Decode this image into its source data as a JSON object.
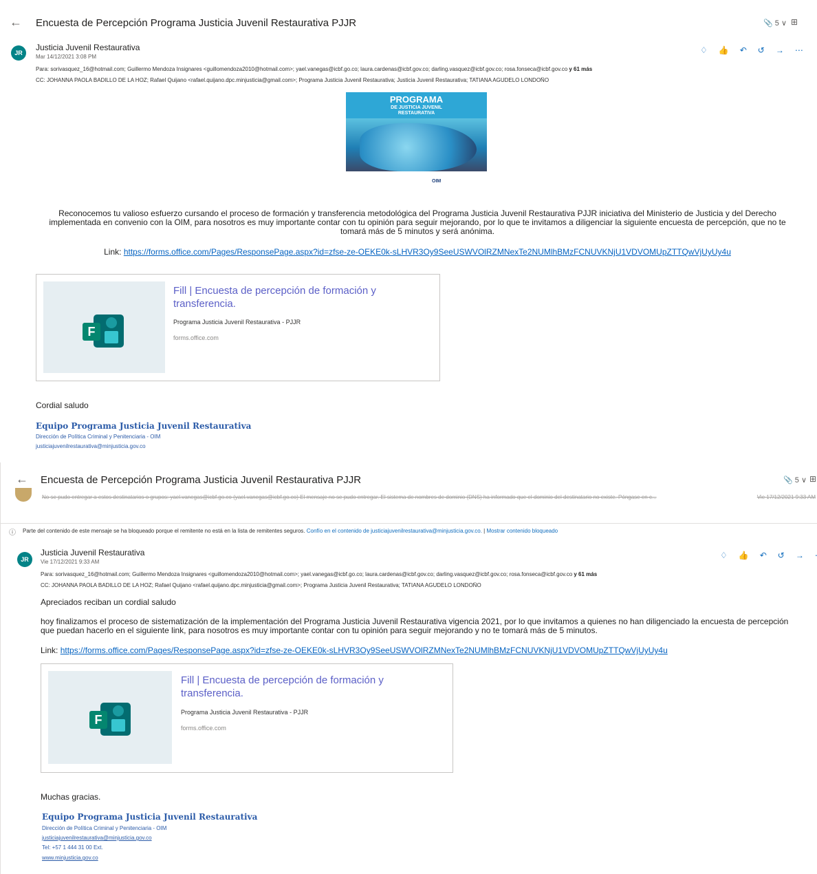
{
  "email1": {
    "subject": "Encuesta de Percepción Programa Justicia Juvenil Restaurativa PJJR",
    "attachments_count": "5",
    "avatar_initials": "JR",
    "sender": "Justicia Juvenil Restaurativa",
    "date": "Mar 14/12/2021 3:08 PM",
    "to_label": "Para:",
    "to_list": "sorivasquez_16@hotmail.com; Guillermo Mendoza Insignares <guillomendoza2010@hotmail.com>; yael.vanegas@icbf.go.co; laura.cardenas@icbf.gov.co; darling.vasquez@icbf.gov.co; rosa.fonseca@icbf.gov.co",
    "to_more": "y 61 más",
    "cc_label": "CC:",
    "cc_list": "JOHANNA PAOLA BADILLO DE LA HOZ; Rafael Quijano <rafael.quijano.dpc.minjusticia@gmail.com>; Programa Justicia Juvenil Restaurativa; Justicia Juvenil Restaurativa; TATIANA AGUDELO LONDOÑO",
    "banner": {
      "line1": "PROGRAMA",
      "line2": "DE JUSTICIA JUVENIL",
      "line3": "RESTAURATIVA",
      "logos": "OIM"
    },
    "body": "Reconocemos tu valioso esfuerzo cursando el proceso de formación y transferencia metodológica del Programa Justicia Juvenil Restaurativa PJJR iniciativa del Ministerio de Justicia y del Derecho implementada en convenio con la OIM, para nosotros es muy importante contar con tu opinión para seguir mejorando, por lo que te invitamos a diligenciar la siguiente encuesta de percepción, que no te tomará más de 5 minutos y será anónima.",
    "link_label": "Link:",
    "link_url": "https://forms.office.com/Pages/ResponsePage.aspx?id=zfse-ze-OEKE0k-sLHVR3Oy9SeeUSWVOlRZMNexTe2NUMlhBMzFCNUVKNjU1VDVOMUpZTTQwVjUyUy4u",
    "card": {
      "title": "Fill | Encuesta de percepción de formación y transferencia.",
      "org": "Programa Justicia Juvenil Restaurativa - PJJR",
      "domain": "forms.office.com",
      "icon_letter": "F"
    },
    "closing": "Cordial saludo",
    "sig_name": "Equipo Programa Justicia Juvenil Restaurativa",
    "sig_dept": "Dirección de Política Criminal y Penitenciaria - OIM",
    "sig_email": "justiciajuvenilrestaurativa@minjusticia.gov.co"
  },
  "email2": {
    "subject": "Encuesta de Percepción Programa Justicia Juvenil Restaurativa PJJR",
    "attachments_count": "5",
    "ndr_text": "No se pudo entregar a estos destinatarios o grupos: yael.vanegas@icbf.go.co (yael.vanegas@icbf.go.co) El mensaje no se pudo entregar. El sistema de nombres de dominio (DNS) ha informado que el dominio del destinatario no existe. Póngase en c...",
    "ndr_date": "Vie 17/12/2021 9:33 AM",
    "blocked_text": "Parte del contenido de este mensaje se ha bloqueado porque el remitente no está en la lista de remitentes seguros.",
    "blocked_trust": "Confío en el contenido de justiciajuvenilrestaurativa@minjusticia.gov.co.",
    "blocked_sep": "|",
    "blocked_show": "Mostrar contenido bloqueado",
    "avatar_initials": "JR",
    "sender": "Justicia Juvenil Restaurativa",
    "date": "Vie 17/12/2021 9:33 AM",
    "to_label": "Para:",
    "to_list": "sorivasquez_16@hotmail.com; Guillermo Mendoza Insignares <guillomendoza2010@hotmail.com>; yael.vanegas@icbf.go.co; laura.cardenas@icbf.gov.co; darling.vasquez@icbf.gov.co; rosa.fonseca@icbf.gov.co",
    "to_more": "y 61 más",
    "cc_label": "CC:",
    "cc_list": "JOHANNA PAOLA BADILLO DE LA HOZ; Rafael Quijano <rafael.quijano.dpc.minjusticia@gmail.com>; Programa Justicia Juvenil Restaurativa; TATIANA AGUDELO LONDOÑO",
    "greeting": "Apreciados reciban un cordial saludo",
    "body": "hoy finalizamos el proceso de sistematización de la implementación del Programa Justicia Juvenil Restaurativa vigencia 2021, por lo que invitamos a quienes no han diligenciado la encuesta de percepción que puedan hacerlo en el siguiente link, para nosotros es muy importante contar con tu opinión para seguir mejorando y no te tomará más de 5 minutos.",
    "link_label": "Link:",
    "link_url": "https://forms.office.com/Pages/ResponsePage.aspx?id=zfse-ze-OEKE0k-sLHVR3Oy9SeeUSWVOlRZMNexTe2NUMlhBMzFCNUVKNjU1VDVOMUpZTTQwVjUyUy4u",
    "card": {
      "title": "Fill | Encuesta de percepción de formación y transferencia.",
      "org": "Programa Justicia Juvenil Restaurativa - PJJR",
      "domain": "forms.office.com",
      "icon_letter": "F"
    },
    "closing": "Muchas gracias.",
    "sig_name": "Equipo Programa Justicia Juvenil Restaurativa",
    "sig_dept": "Dirección de Política Criminal y Penitenciaria - OIM",
    "sig_email": "justiciajuvenilrestaurativa@minjusticia.gov.co",
    "sig_tel": "Tel: +57 1 444 31 00 Ext.",
    "sig_web": "www.minjusticia.gov.co"
  },
  "icons": {
    "back": "←",
    "paperclip": "📎",
    "chevron": "∨",
    "expand": "⊞",
    "info": "ⓘ"
  },
  "colors": {
    "avatar": "#038387",
    "accent": "#0f6cbd",
    "link": "#0563c1",
    "card_title": "#5b5fc7",
    "signature": "#2b5ba8"
  }
}
